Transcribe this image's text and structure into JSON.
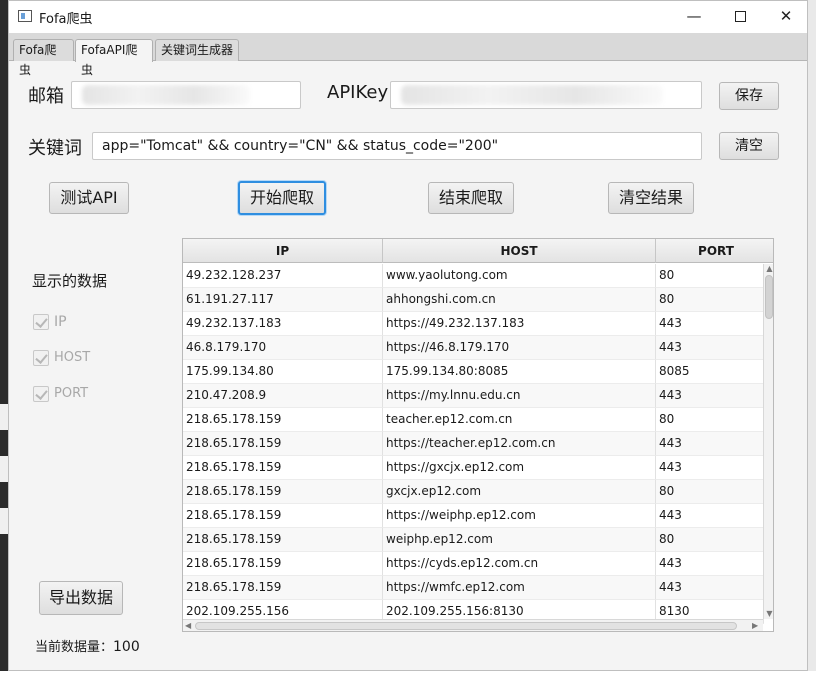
{
  "window": {
    "title": "Fofa爬虫"
  },
  "tabs": [
    {
      "label": "Fofa爬虫",
      "active": false
    },
    {
      "label": "FofaAPI爬虫",
      "active": true
    },
    {
      "label": "关键词生成器",
      "active": false
    }
  ],
  "form": {
    "email_label": "邮箱",
    "email_value": "",
    "apikey_label": "APIKey",
    "apikey_value": "",
    "save_label": "保存",
    "keyword_label": "关键词",
    "keyword_value": "app=\"Tomcat\" && country=\"CN\" && status_code=\"200\"",
    "clear_label": "清空"
  },
  "actions": {
    "test_api": "测试API",
    "start": "开始爬取",
    "stop": "结束爬取",
    "clear_results": "清空结果",
    "export": "导出数据"
  },
  "display_options": {
    "title": "显示的数据",
    "items": [
      {
        "label": "IP",
        "checked": true
      },
      {
        "label": "HOST",
        "checked": true
      },
      {
        "label": "PORT",
        "checked": true
      }
    ]
  },
  "table": {
    "columns": [
      "IP",
      "HOST",
      "PORT"
    ],
    "rows": [
      [
        "49.232.128.237",
        "www.yaolutong.com",
        "80"
      ],
      [
        "61.191.27.117",
        "ahhongshi.com.cn",
        "80"
      ],
      [
        "49.232.137.183",
        "https://49.232.137.183",
        "443"
      ],
      [
        "46.8.179.170",
        "https://46.8.179.170",
        "443"
      ],
      [
        "175.99.134.80",
        "175.99.134.80:8085",
        "8085"
      ],
      [
        "210.47.208.9",
        "https://my.lnnu.edu.cn",
        "443"
      ],
      [
        "218.65.178.159",
        "teacher.ep12.com.cn",
        "80"
      ],
      [
        "218.65.178.159",
        "https://teacher.ep12.com.cn",
        "443"
      ],
      [
        "218.65.178.159",
        "https://gxcjx.ep12.com",
        "443"
      ],
      [
        "218.65.178.159",
        "gxcjx.ep12.com",
        "80"
      ],
      [
        "218.65.178.159",
        "https://weiphp.ep12.com",
        "443"
      ],
      [
        "218.65.178.159",
        "weiphp.ep12.com",
        "80"
      ],
      [
        "218.65.178.159",
        "https://cyds.ep12.com.cn",
        "443"
      ],
      [
        "218.65.178.159",
        "https://wmfc.ep12.com",
        "443"
      ],
      [
        "202.109.255.156",
        "202.109.255.156:8130",
        "8130"
      ]
    ]
  },
  "status": {
    "count_label": "当前数据量：",
    "count_value": "100"
  }
}
